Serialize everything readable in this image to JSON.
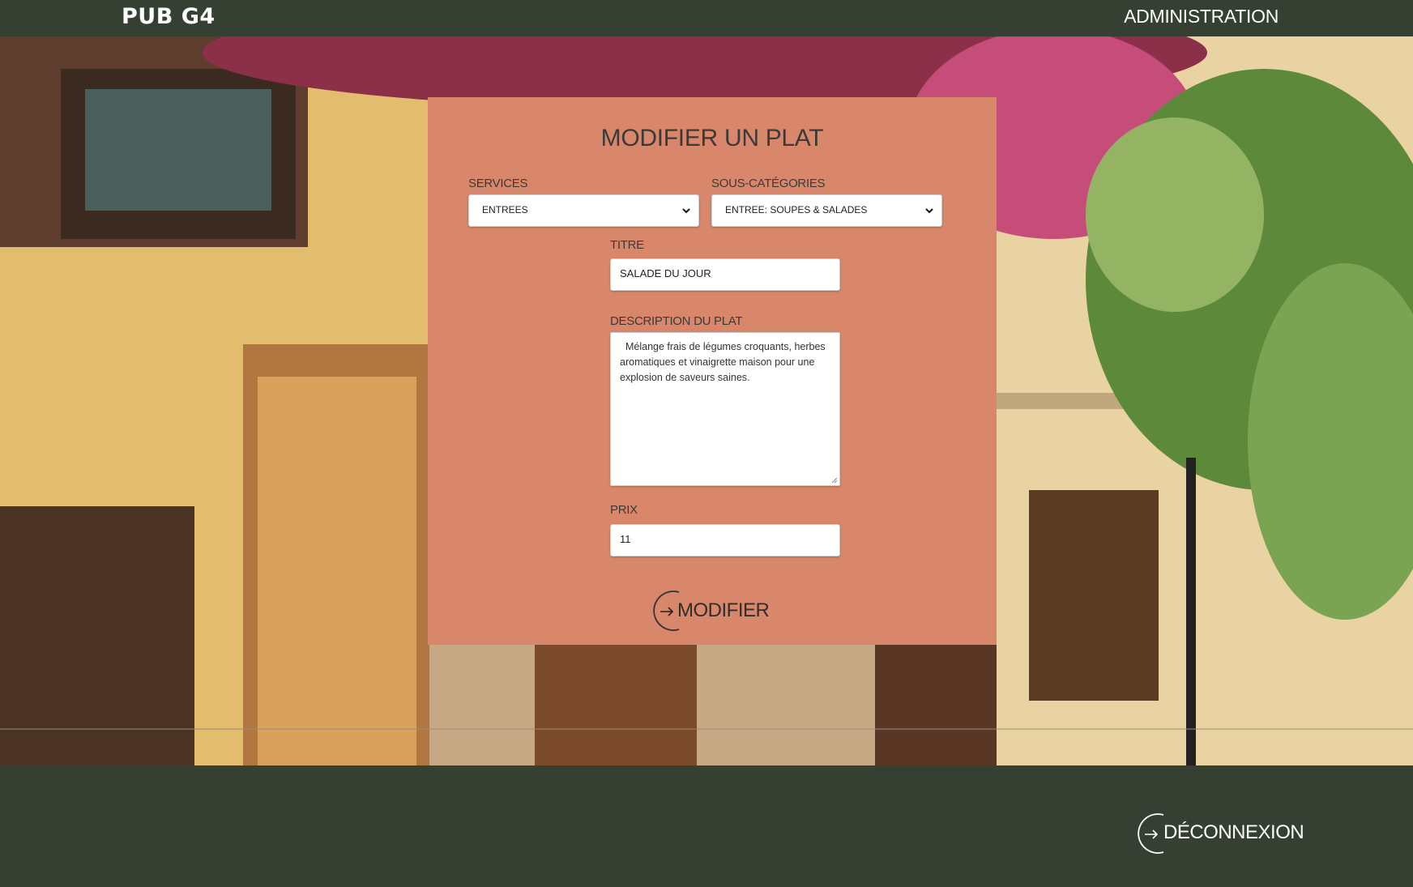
{
  "header": {
    "brand": "PUB G4",
    "admin_link": "ADMINISTRATION"
  },
  "form": {
    "title": "MODIFIER UN PLAT",
    "services": {
      "label": "SERVICES",
      "selected": "ENTREES"
    },
    "subcategories": {
      "label": "SOUS-CATÉGORIES",
      "selected": "ENTREE: SOUPES & SALADES"
    },
    "titre": {
      "label": "TITRE",
      "value": "SALADE DU JOUR"
    },
    "description": {
      "label": "DESCRIPTION DU PLAT",
      "value": "Mélange frais de légumes croquants, herbes aromatiques et vinaigrette maison pour une explosion de saveurs saines."
    },
    "prix": {
      "label": "PRIX",
      "value": "11"
    },
    "submit_label": "MODIFIER"
  },
  "footer": {
    "logout_label": "DÉCONNEXION"
  },
  "colors": {
    "dark_green": "#354033",
    "card_terracotta": "#d9876a",
    "text_dark": "#3a3a3a"
  }
}
